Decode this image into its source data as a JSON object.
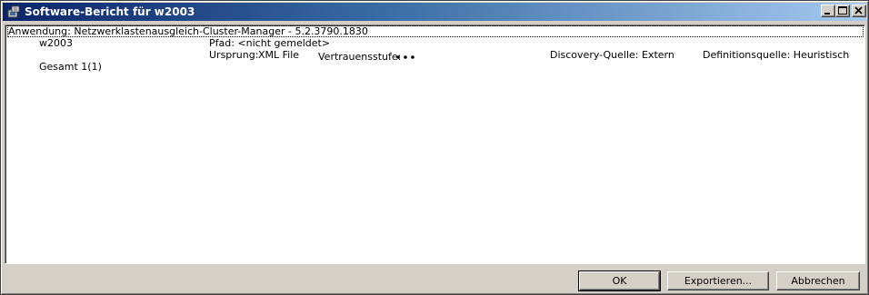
{
  "window": {
    "title": "Software-Bericht für w2003",
    "icon": "software-report-icon"
  },
  "report": {
    "application_line": "Anwendung: Netzwerklastenausgleich-Cluster-Manager - 5.2.3790.1830",
    "computer": "w2003",
    "path": "Pfad: <nicht gemeldet>",
    "origin_label": "Ursprung:",
    "origin_value": "XML File",
    "trust_label": "Vertrauensstufe:",
    "trust_level_dots": 3,
    "discovery_source": "Discovery-Quelle: Extern",
    "definition_source": "Definitionsquelle: Heuristisch",
    "total": "Gesamt 1(1)"
  },
  "buttons": {
    "ok": "OK",
    "export": "Exportieren...",
    "cancel": "Abbrechen"
  }
}
